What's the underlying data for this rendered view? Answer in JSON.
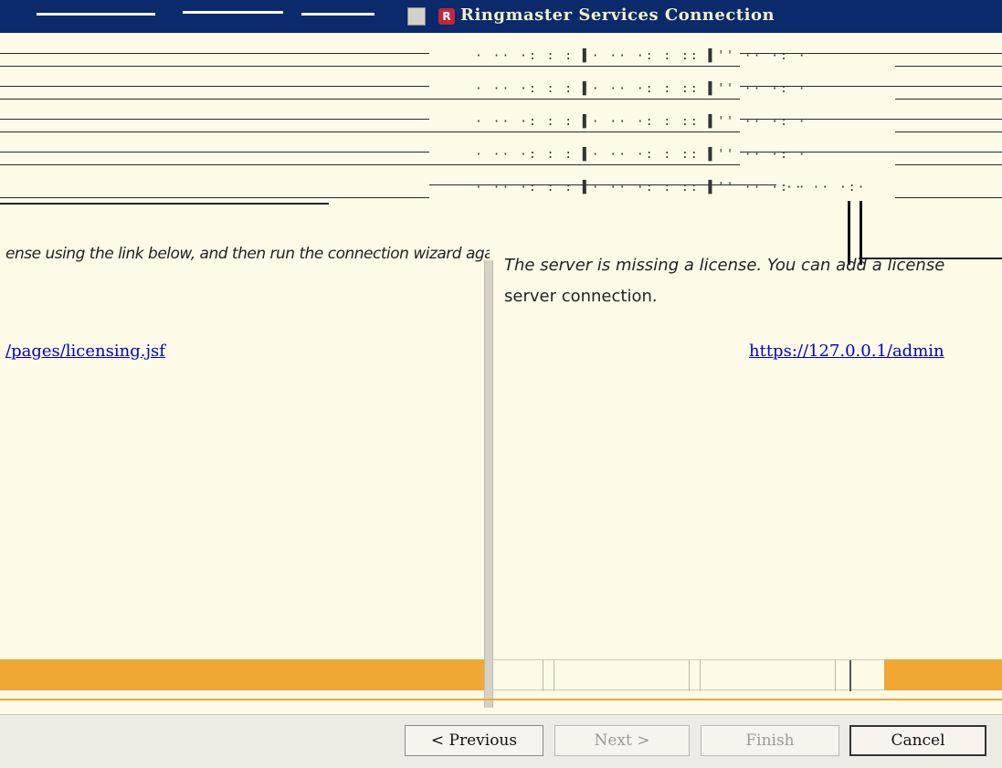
{
  "window": {
    "title": "Ringmaster Services Connection",
    "app_icon_letter": "R"
  },
  "stripes": {
    "text": "· ·· ·: : :  ▌· ·· ·: : :: ▌'' ·· ·: ·",
    "extra": "·· ·· ·:·"
  },
  "message": {
    "left_fragment": "ense using the link below, and then run the connection wizard again to enable this",
    "right_line1": "The server is missing a license. You can add a license",
    "right_line2": "server connection."
  },
  "links": {
    "left": "/pages/licensing.jsf",
    "right": "https://127.0.0.1/admin"
  },
  "buttons": {
    "previous": "< Previous",
    "next": "Next >",
    "finish": "Finish",
    "cancel": "Cancel"
  },
  "colors": {
    "titlebar": "#0a2a6b",
    "background": "#fdfbe8",
    "band": "#f0a733",
    "link": "#0000cc"
  }
}
